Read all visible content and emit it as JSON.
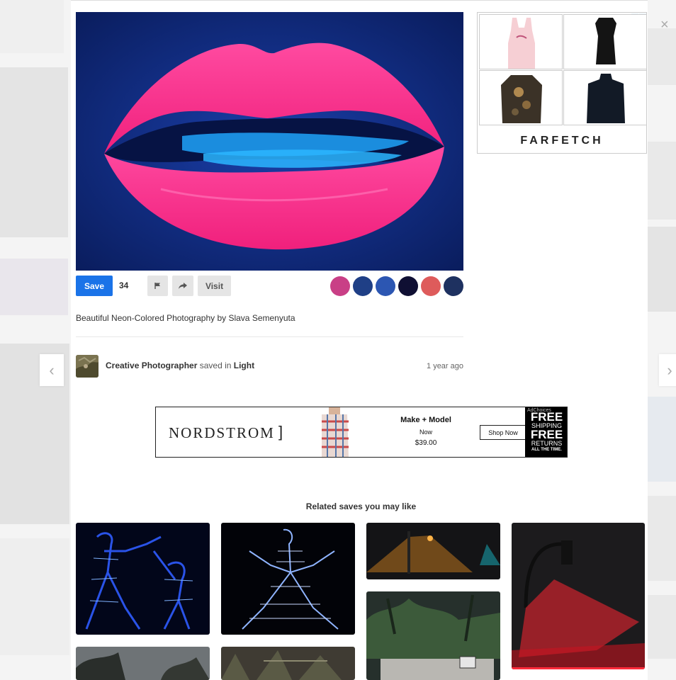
{
  "pin": {
    "save_label": "Save",
    "save_count": "34",
    "visit_label": "Visit",
    "description": "Beautiful Neon-Colored Photography by Slava Semenyuta",
    "palette": [
      "#c93f86",
      "#1f3f86",
      "#2c56b2",
      "#0f0f33",
      "#de5b5b",
      "#1e3160"
    ],
    "icons": [
      "flag-icon",
      "share-arrow-icon",
      "close-icon",
      "chevron-left-icon",
      "chevron-right-icon"
    ]
  },
  "attribution": {
    "user": "Creative Photographer",
    "saved_in_text": "saved in",
    "board": "Light",
    "time": "1 year ago"
  },
  "navigation": {
    "close": "×",
    "prev": "‹",
    "next": "›"
  },
  "side_ad": {
    "brand": "FARFETCH"
  },
  "banner_ad": {
    "brand": "NORDSTROM",
    "bracket": "]",
    "product": "Make + Model",
    "status": "Now",
    "price": "$39.00",
    "cta": "Shop Now",
    "badge_line1": "FREE",
    "badge_line2": "SHIPPING",
    "badge_line3": "FREE",
    "badge_line4": "RETURNS",
    "badge_line5": "ALL THE TIME.",
    "adchoices": "AdChoices"
  },
  "related": {
    "heading": "Related saves you may like"
  }
}
